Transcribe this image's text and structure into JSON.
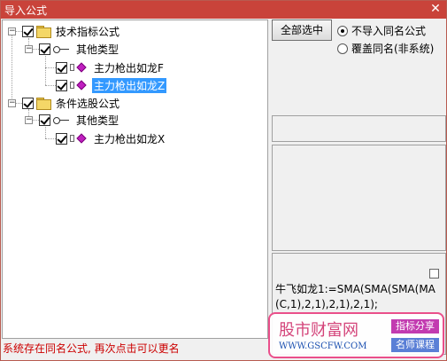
{
  "window": {
    "title": "导入公式",
    "close_glyph": "✕"
  },
  "tree": {
    "nodes": [
      {
        "id": "root1",
        "label": "技术指标公式",
        "checked": true,
        "expanded": true
      },
      {
        "id": "root1-child",
        "label": "其他类型",
        "checked": true,
        "expanded": true
      },
      {
        "id": "f1",
        "label": "主力枪出如龙F",
        "checked": true
      },
      {
        "id": "f2",
        "label": "主力枪出如龙Z",
        "checked": true,
        "selected": true
      },
      {
        "id": "root2",
        "label": "条件选股公式",
        "checked": true,
        "expanded": true
      },
      {
        "id": "root2-child",
        "label": "其他类型",
        "checked": true,
        "expanded": true
      },
      {
        "id": "f3",
        "label": "主力枪出如龙X",
        "checked": true
      }
    ],
    "expander_glyph": "−"
  },
  "controls": {
    "select_all_label": "全部选中",
    "radio_no_import_label": "不导入同名公式",
    "radio_overwrite_label": "覆盖同名(非系统)",
    "radio_selected": "no_import"
  },
  "preview": {
    "formula_text": "牛飞如龙1:=SMA(SMA(SMA(MA(C,1),2,1),2,1),2,1);",
    "checkbox_checked": false
  },
  "status": {
    "message": "系统存在同名公式, 再次点击可以更名"
  },
  "watermark": {
    "title": "股市财富网",
    "url": "WWW.GSCFW.COM",
    "tag1": "指标分享",
    "tag2": "名师课程"
  },
  "colors": {
    "titlebar": "#c9433a",
    "selection": "#3399ff",
    "status": "#cc0000"
  }
}
